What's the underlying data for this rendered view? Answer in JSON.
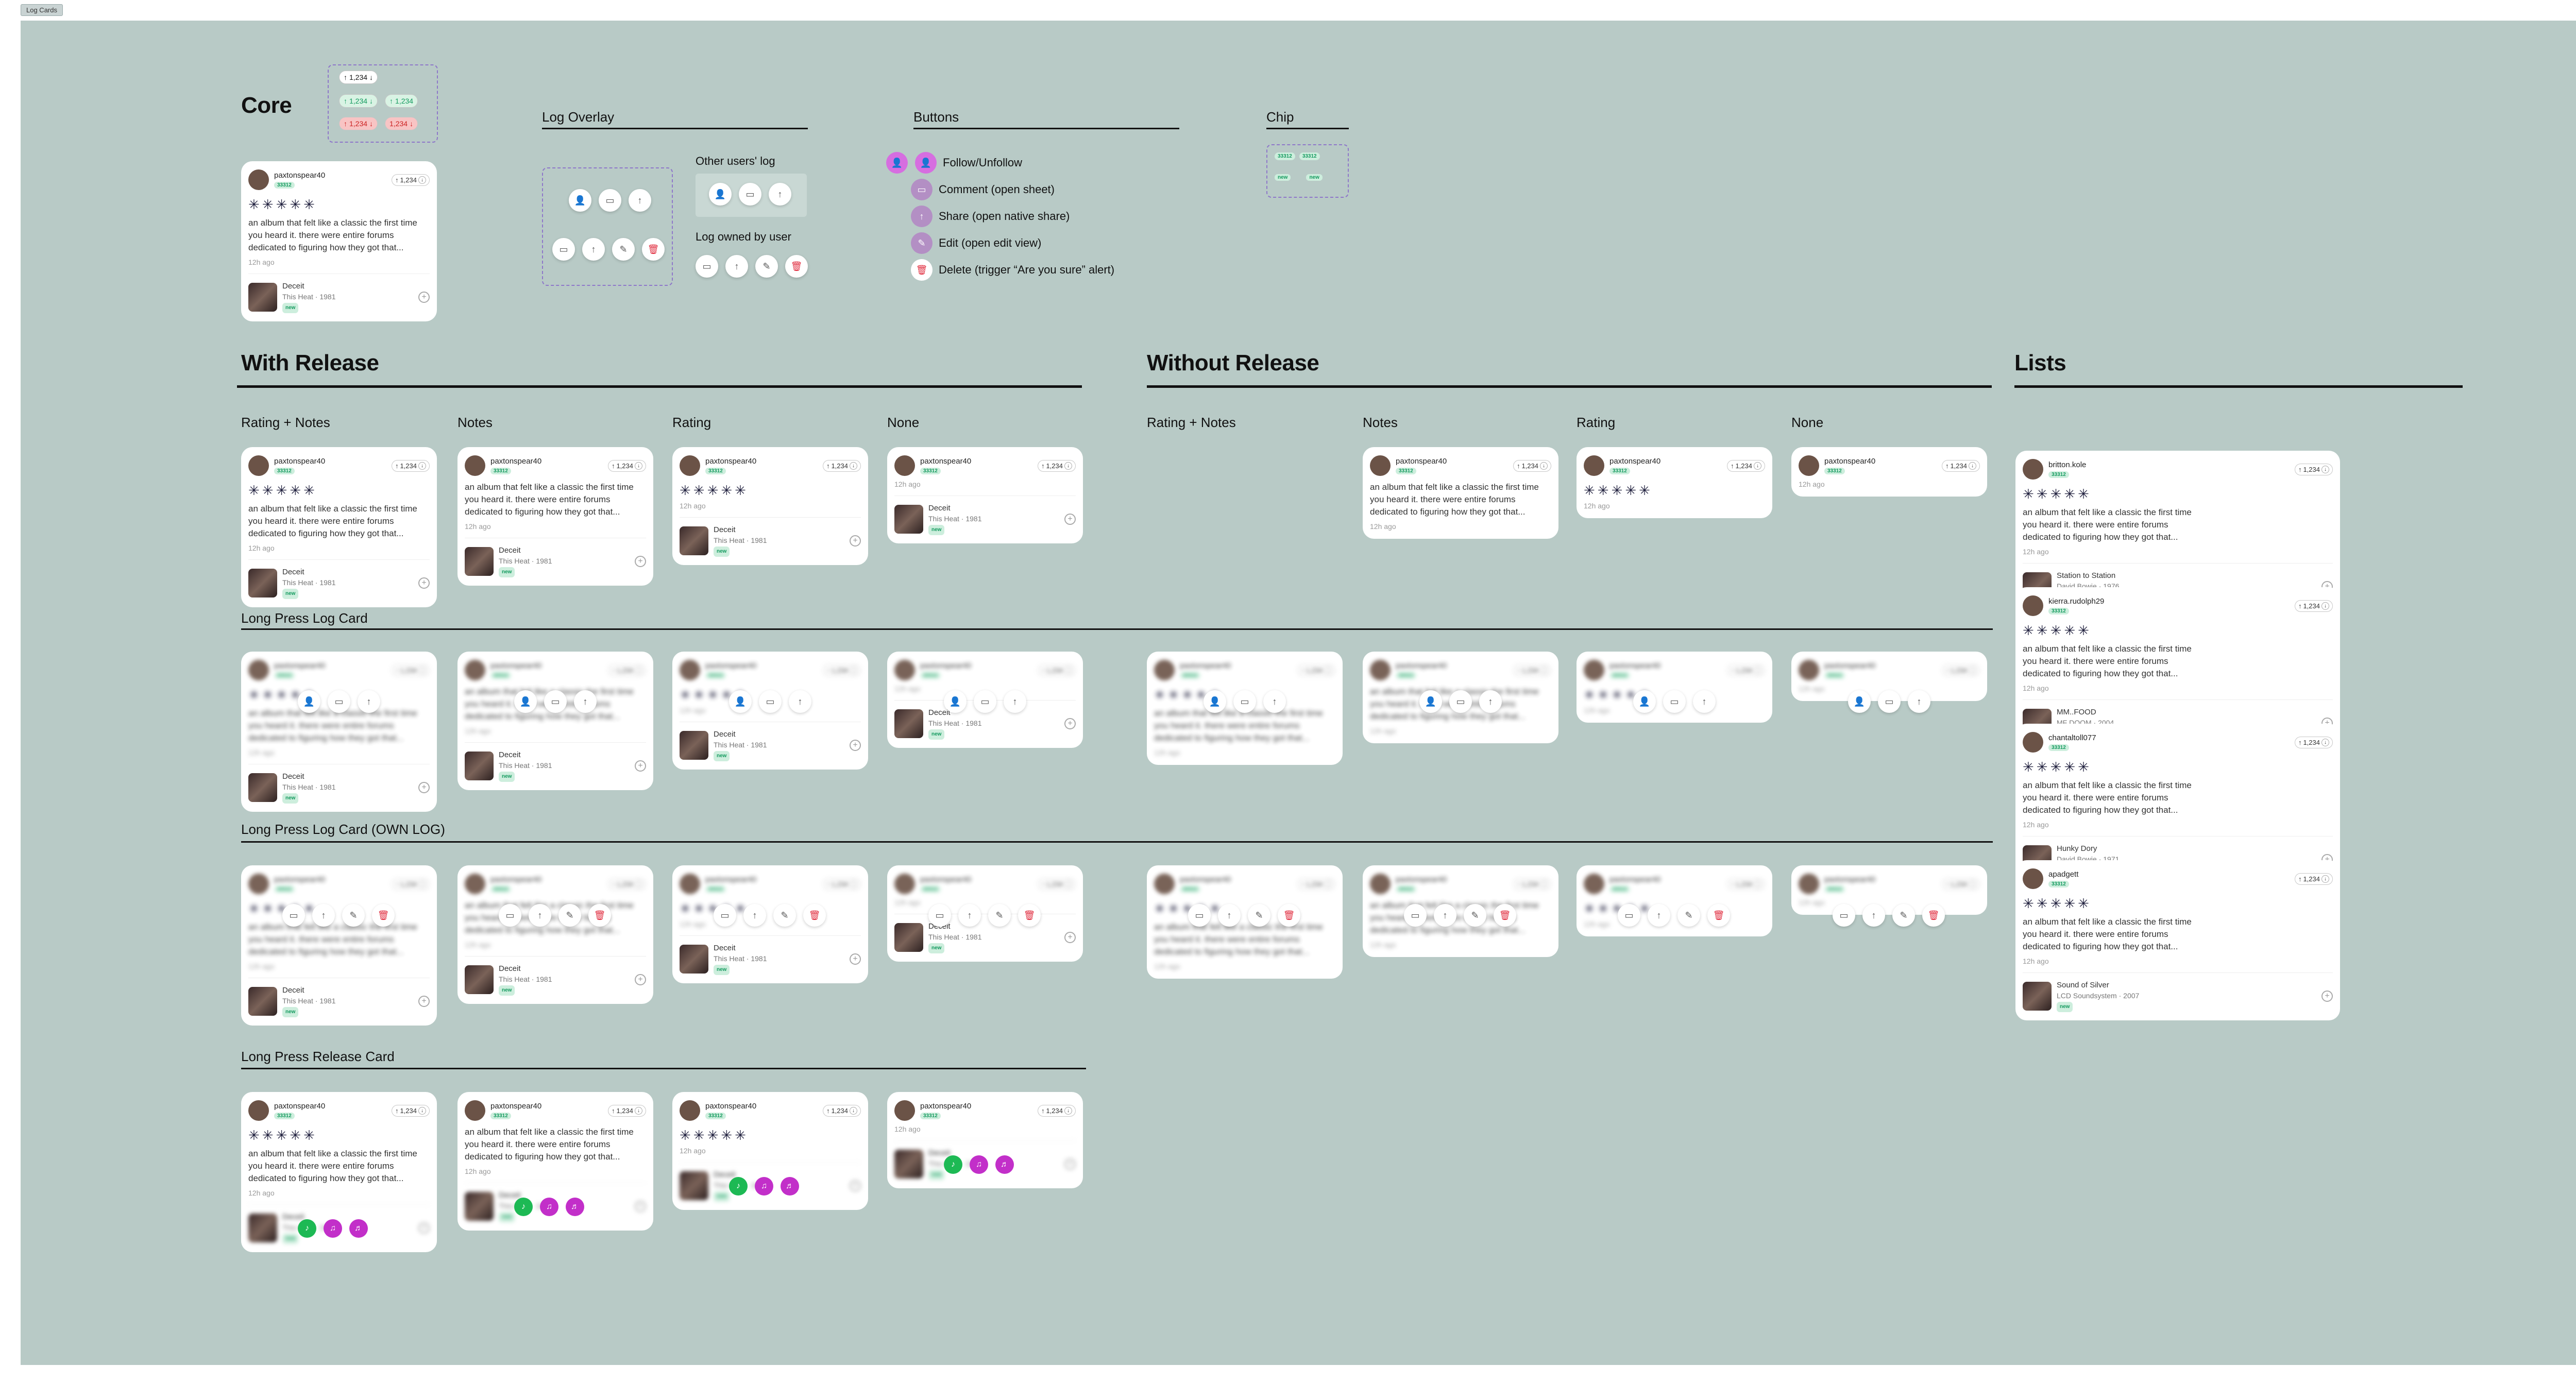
{
  "frame_label": "Log Cards",
  "sections": {
    "core": "Core",
    "log_overlay": "Log Overlay",
    "buttons": "Buttons",
    "chip": "Chip",
    "with_release": "With Release",
    "without_release": "Without Release",
    "lists": "Lists",
    "long_press_log": "Long Press Log Card",
    "long_press_own": "Long Press Log Card (OWN LOG)",
    "long_press_release": "Long Press Release Card"
  },
  "columns": {
    "rating_notes": "Rating + Notes",
    "notes": "Notes",
    "rating": "Rating",
    "none": "None"
  },
  "overlay": {
    "other_users": "Other users' log",
    "owned": "Log owned by user"
  },
  "buttons": {
    "follow": "Follow/Unfollow",
    "comment": "Comment (open sheet)",
    "share": "Share (open native share)",
    "edit": "Edit (open edit view)",
    "delete": "Delete (trigger “Are you sure” alert)"
  },
  "chip": {
    "value": "33312",
    "label_new": "new"
  },
  "vote": {
    "count": "1,234"
  },
  "log": {
    "username": "paxtonspear40",
    "xp": "33312",
    "stars": "✳✳✳✳✳",
    "note": "an album that felt like a classic the first time you heard it. there were entire forums dedicated to figuring how they got that...",
    "ago": "12h ago"
  },
  "release": {
    "title": "Deceit",
    "artist_year": "This Heat · 1981",
    "badge": "new"
  },
  "lists": [
    {
      "username": "britton.kole",
      "release": "Station to Station",
      "sub": "David Bowie · 1976",
      "ago": "12h ago"
    },
    {
      "username": "kierra.rudolph29",
      "release": "MM..FOOD",
      "sub": "MF DOOM · 2004",
      "ago": "12h ago"
    },
    {
      "username": "chantaltoll077",
      "release": "Hunky Dory",
      "sub": "David Bowie · 1971",
      "ago": "12h ago"
    },
    {
      "username": "apadgett",
      "release": "Sound of Silver",
      "sub": "LCD Soundsystem · 2007",
      "ago": "12h ago"
    }
  ],
  "colors": {
    "canvas": "#b8cac6",
    "accent_purple": "#b38fc4",
    "delete_red": "#e02b3d",
    "xp_green": "#139a5e",
    "spotify": "#1db954",
    "pink": "#c22fc9"
  }
}
